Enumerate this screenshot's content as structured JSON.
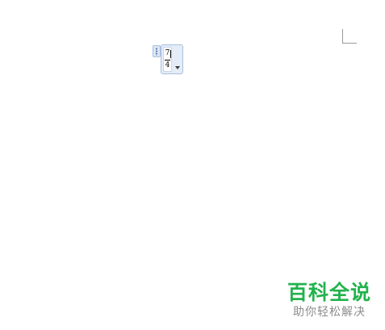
{
  "document": {
    "equation": {
      "numerator": "7",
      "denominator": "4",
      "dropdown_icon": "chevron-down-icon",
      "handle_icon": "drag-handle-icon"
    },
    "corner_mark_icon": "page-corner-mark"
  },
  "watermark": {
    "title": "百科全说",
    "subtitle": "助你轻松解决",
    "title_color": "#22b24c",
    "subtitle_color": "#8c8c8c"
  },
  "colors": {
    "background": "#ffffff",
    "equation_box": "#e4ecf7",
    "equation_border": "#a9bfdf"
  }
}
